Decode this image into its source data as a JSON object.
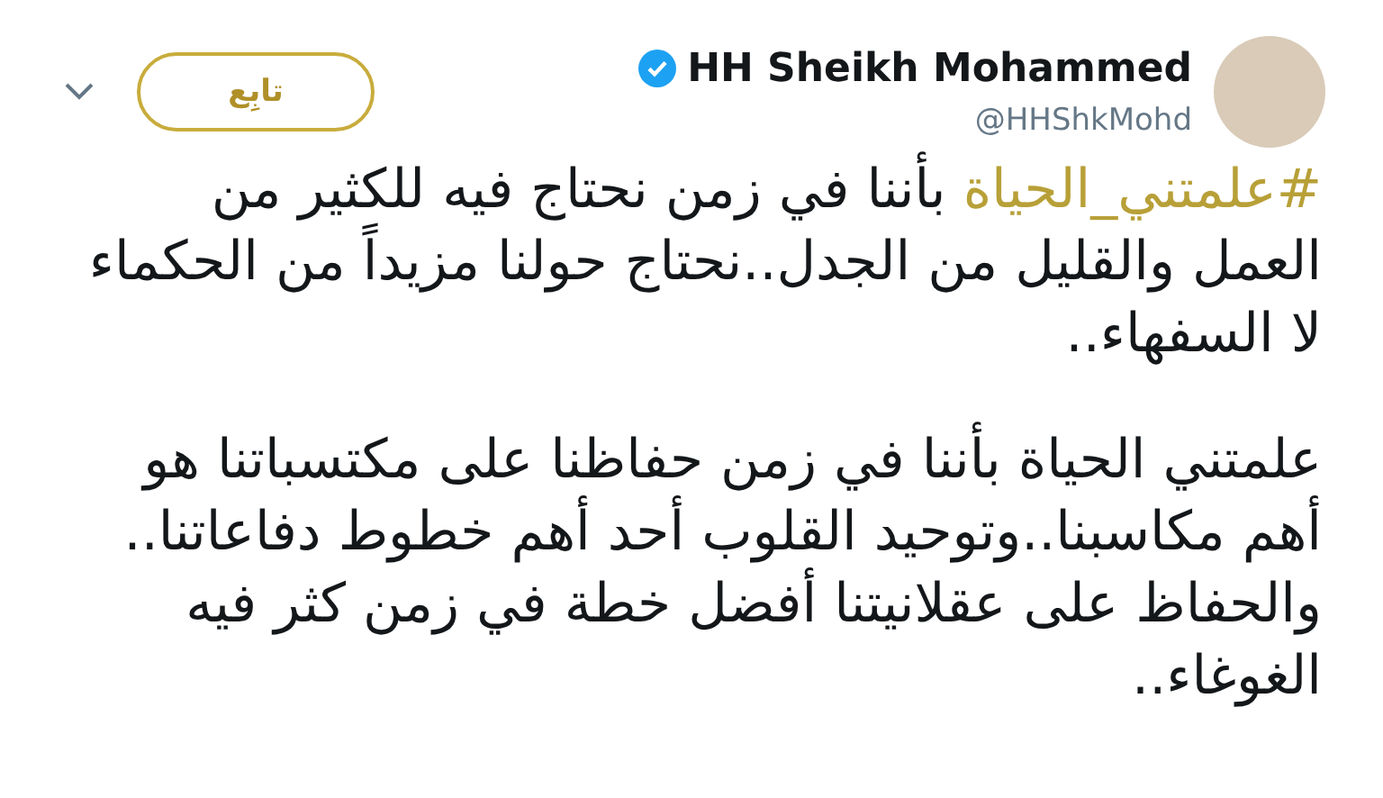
{
  "author": {
    "name": "HH Sheikh Mohammed",
    "handle": "@HHShkMohd",
    "verified": true
  },
  "follow_button": {
    "label": "تابِع"
  },
  "tweet": {
    "paragraphs": [
      {
        "hashtag": "#علمتني_الحياة",
        "text": "بأننا في زمن نحتاج فيه للكثير من العمل والقليل من الجدل..نحتاج حولنا مزيداً من الحكماء لا السفهاء.."
      },
      {
        "text": "علمتني الحياة بأننا في زمن حفاظنا على مكتسباتنا هو أهم مكاسبنا..وتوحيد القلوب أحد أهم خطوط دفاعاتنا.. والحفاظ على عقلانيتنا أفضل خطة في زمن كثر فيه الغوغاء.."
      }
    ]
  }
}
